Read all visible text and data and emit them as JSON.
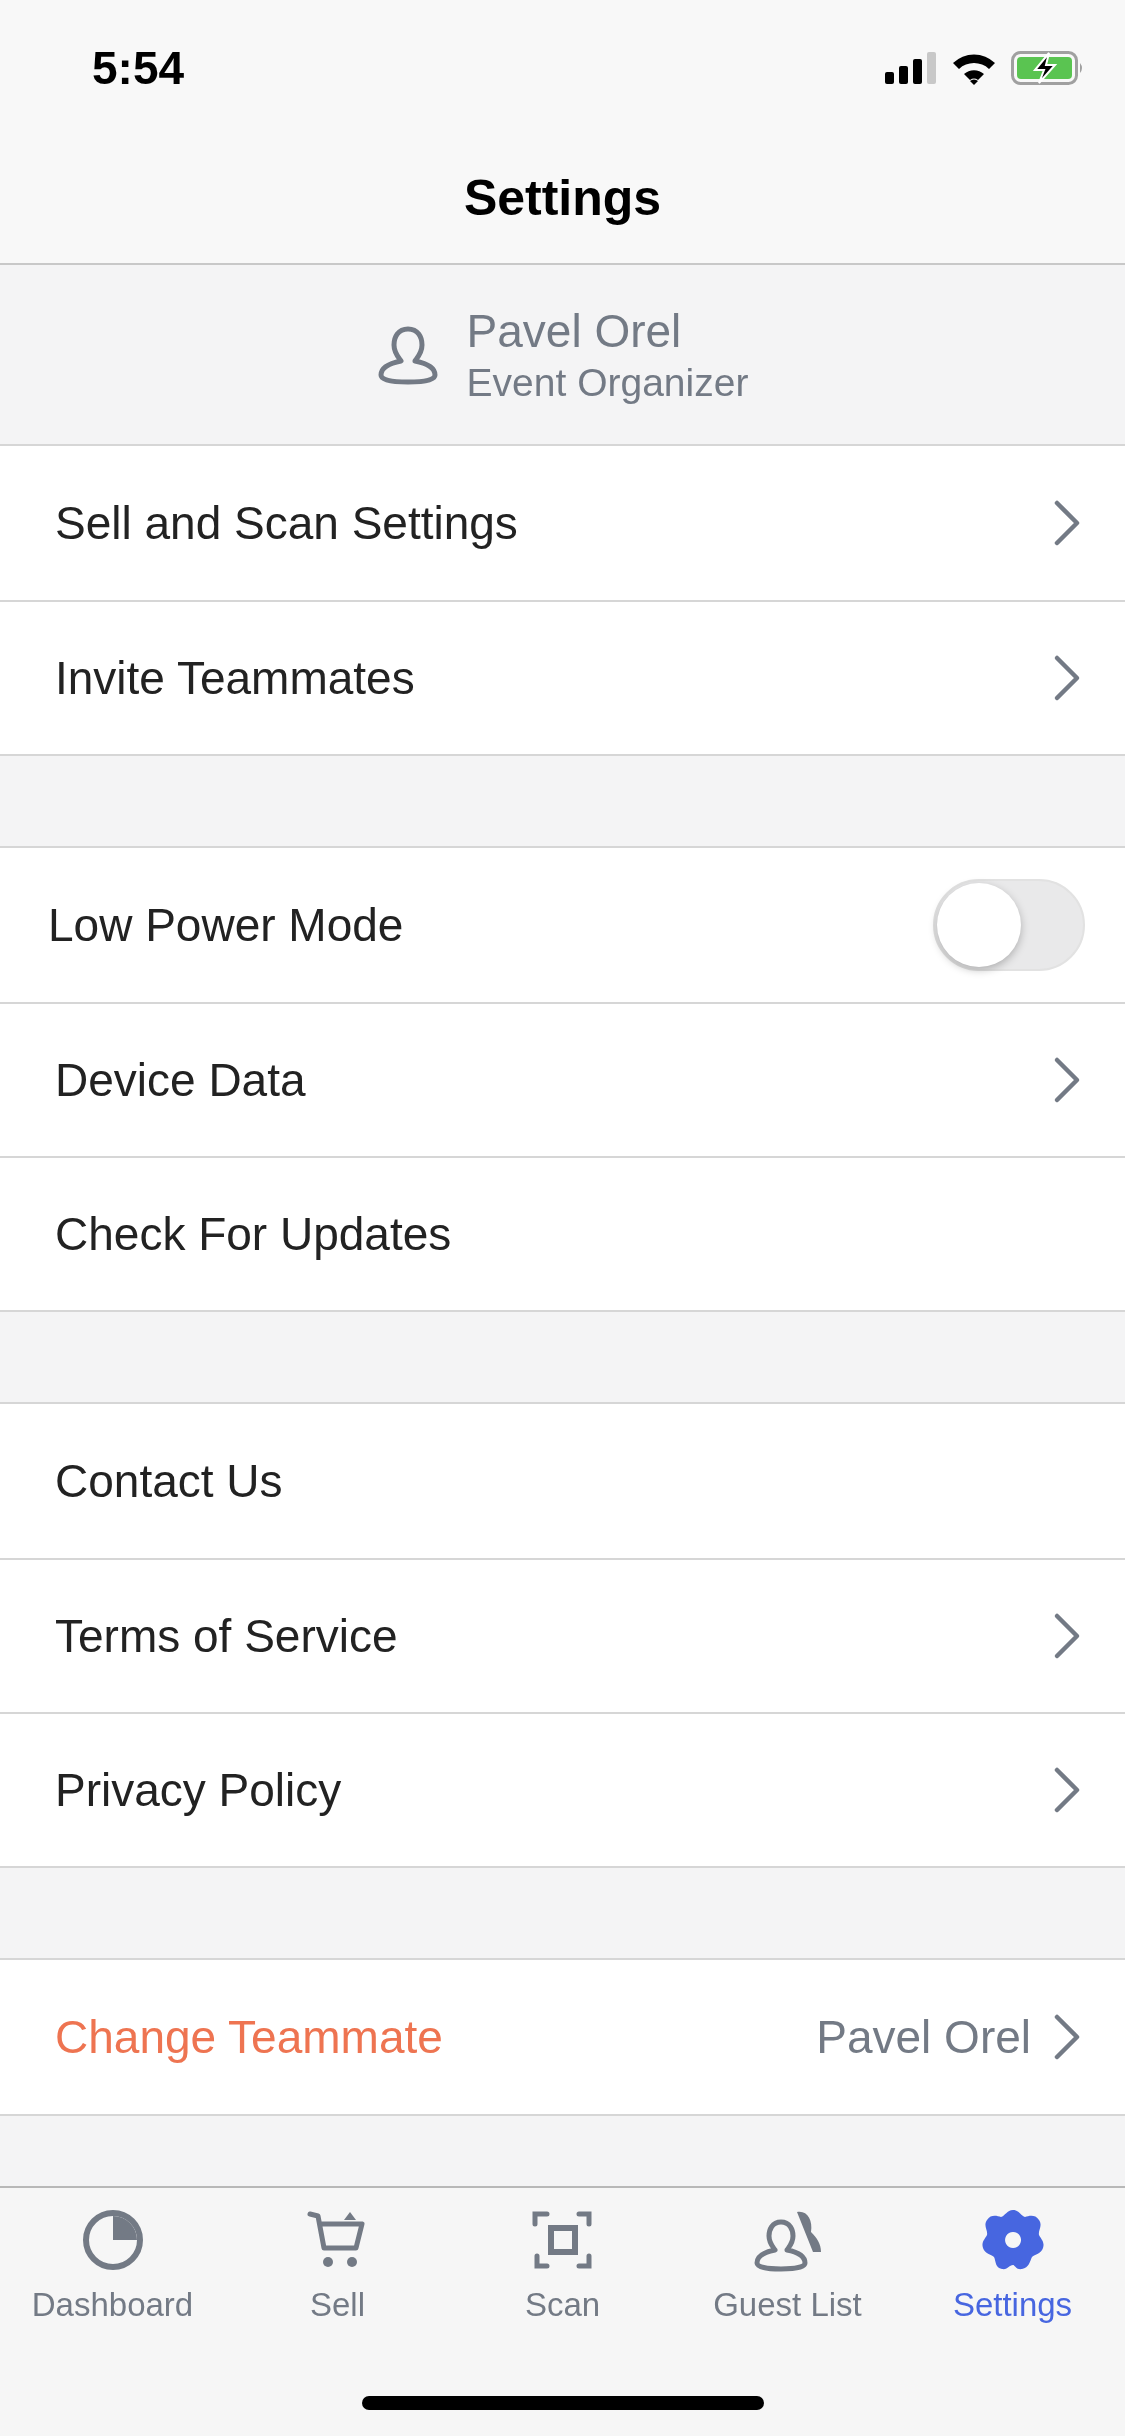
{
  "status_bar": {
    "time": "5:54"
  },
  "nav": {
    "title": "Settings"
  },
  "profile": {
    "name": "Pavel Orel",
    "role": "Event Organizer"
  },
  "sections": [
    [
      {
        "kind": "nav",
        "label": "Sell and Scan Settings"
      },
      {
        "kind": "nav",
        "label": "Invite Teammates"
      }
    ],
    [
      {
        "kind": "toggle",
        "label": "Low Power Mode",
        "on": false
      },
      {
        "kind": "nav",
        "label": "Device Data"
      },
      {
        "kind": "action",
        "label": "Check For Updates"
      }
    ],
    [
      {
        "kind": "action",
        "label": "Contact Us"
      },
      {
        "kind": "nav",
        "label": "Terms of Service"
      },
      {
        "kind": "nav",
        "label": "Privacy Policy"
      }
    ],
    [
      {
        "kind": "teammate",
        "label": "Change Teammate",
        "value": "Pavel Orel"
      }
    ]
  ],
  "tabs": [
    {
      "label": "Dashboard",
      "selected": false
    },
    {
      "label": "Sell",
      "selected": false
    },
    {
      "label": "Scan",
      "selected": false
    },
    {
      "label": "Guest List",
      "selected": false
    },
    {
      "label": "Settings",
      "selected": true
    }
  ]
}
